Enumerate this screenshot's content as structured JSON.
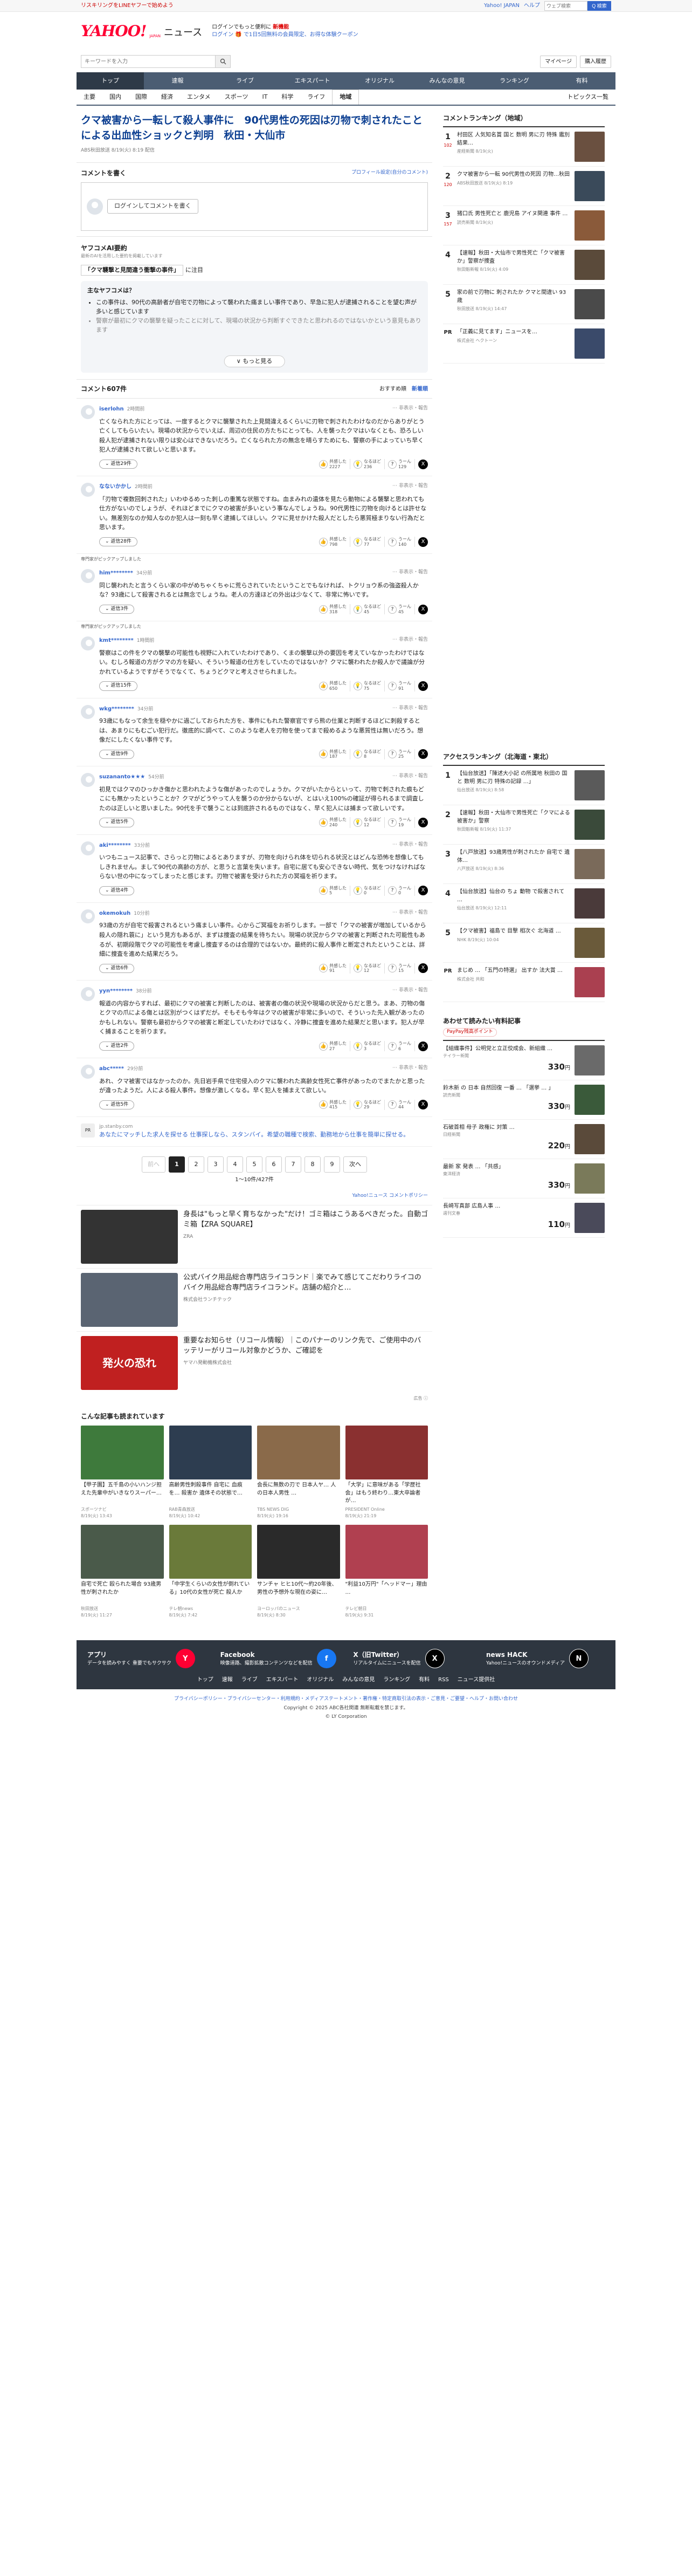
{
  "topbar": {
    "promo": "リスキリングをLINEヤフーで始めよう",
    "links": [
      "Yahoo! JAPAN",
      "ヘルプ"
    ],
    "search_placeholder": "ウェブ検索",
    "search_btn": "Q 検索"
  },
  "header": {
    "logo": "YAHOO!",
    "logo_sub": "JAPAN",
    "service": "ニュース",
    "promo1": "ログインでもっと便利に",
    "promo2": "ログイン 🎁 で1日5回無料の会員限定、お得な体験クーポン",
    "promo_highlight": "新機能"
  },
  "search": {
    "placeholder": "キーワードを入力",
    "actions": [
      "マイページ",
      "購入履歴"
    ]
  },
  "gnav": [
    "トップ",
    "速報",
    "ライブ",
    "エキスパート",
    "オリジナル",
    "みんなの意見",
    "ランキング",
    "有料"
  ],
  "snav": {
    "items": [
      "主要",
      "国内",
      "国際",
      "経済",
      "エンタメ",
      "スポーツ",
      "IT",
      "科学",
      "ライフ",
      "地域"
    ],
    "active": 9,
    "right": "トピックス一覧"
  },
  "article": {
    "title": "クマ被害から一転して殺人事件に　90代男性の死因は刃物で刺されたことによる出血性ショックと判明　秋田・大仙市",
    "meta": "ABS秋田放送 8/19(火) 8:19 配信"
  },
  "comment_form": {
    "heading": "コメントを書く",
    "settings": "プロフィール設定(自分のコメント)",
    "login": "ログインしてコメントを書く"
  },
  "ai": {
    "title": "ヤフコメAI要約",
    "sub": "最新のAIを活用した要約を掲載しています",
    "ref_prefix": "",
    "ref_highlight": "「クマ襲撃と見間違う衝撃の事件」",
    "ref_suffix": "に注目",
    "box_title": "主なヤフコメは？",
    "points": [
      "この事件は、90代の高齢者が自宅で刃物によって襲われた痛ましい事件であり、早急に犯人が逮捕されることを望む声が多いと感じています",
      "警察が最初にクマの襲撃を疑ったことに対して、現場の状況から判断すぐできたと思われるのではないかという意見もあります"
    ],
    "more": "∨ もっと見る"
  },
  "comments_header": {
    "title": "コメント607件",
    "sort1": "おすすめ順",
    "sort2": "新着順"
  },
  "comments": [
    {
      "user": "iserlohn",
      "time": "2時間前",
      "text": "亡くなられた方にとっては、一度するとクマに襲撃された上見間違えるくらいに刃物で刺されたわけなのだからありがとう亡くしてもらいたい。現場の状況からでいえば、周辺の住民の方たちにとっても、人を襲ったクマはいなくとも、恐ろしい殺人犯が逮捕されない限りは安心はできないだろう。亡くなられた方の無念を晴らすためにも、警察の手によっていち早く犯人が逮捕されて欲しいと思います。",
      "reply": "返信29件",
      "r1": "2227",
      "r2": "236",
      "r3": "129"
    },
    {
      "user": "なないかかし",
      "time": "2時間前",
      "text": "「刃物で複数回刺された」いわゆるめった刺しの重篤な状態ですね。血まみれの遺体を見たら動物による襲撃と思われても仕方がないのでしょうが、それほどまでにクマの被害が多いという事なんでしょうね。90代男性に刃物を向けるとは許せない。無差別なのか知人なのか犯人は一刻も早く逮捕してほしい。クマに見せかけた殺人だとしたら悪質極まりない行為だと思います。",
      "reply": "返信28件",
      "r1": "798",
      "r2": "77",
      "r3": "140"
    },
    {
      "user": "him********",
      "time": "34分前",
      "text": "同じ襲われたと言うくらい家の中がめちゃくちゃに荒らされていたということでもなければ、トクリョウ系の強盗殺人かな？93歳にして殺害されるとは無念でしょうね。老人の方達ほどの外出は少なくて、非常に怖いです。",
      "reply": "返信3件",
      "r1": "318",
      "r2": "45",
      "r3": "45",
      "pickup": "専門家がピックアップしました"
    },
    {
      "user": "kmt********",
      "time": "1時間前",
      "text": "警察はこの件をクマの襲撃の可能性も視野に入れていたわけであり、くまの襲撃以外の要因を考えていなかったわけではない。むしろ報道の方がクマの方を疑い、そういう報道の仕方をしていたのではないか？クマに襲われたか殺人かで議論が分かれているようですがそうでなくて、ちょうどクマと考えさせられました。",
      "reply": "返信15件",
      "r1": "650",
      "r2": "75",
      "r3": "91",
      "pickup": "専門家がピックアップしました"
    },
    {
      "user": "wkg********",
      "time": "34分前",
      "text": "93歳にもなって余生を穏やかに過ごしておられた方を、事件にもれた警察官ですら熊の仕業と判断するほどに刺殺するとは、あまりにもむごい犯行だ。徹底的に調べて、このような老人を刃物を使ってまで殺めるような悪質性は無いだろう。想像だにしたくない事件です。",
      "reply": "返信9件",
      "r1": "187",
      "r2": "8",
      "r3": "25"
    },
    {
      "user": "suzananto★★★",
      "time": "54分前",
      "text": "初見ではクマのひっかき傷かと思われたような傷があったのでしょうか。クマがいたからといって、刃物で刺された痕もどこにも無かったということか？クマがどうやって人を襲うのか分からないが、とはいえ100%の確証が得られるまで調査したのは正しいと思いました。90代を手で襲うことは到底許されるものではなく、早く犯人には捕まって欲しいです。",
      "reply": "返信5件",
      "r1": "240",
      "r2": "12",
      "r3": "19"
    },
    {
      "user": "aki********",
      "time": "33分前",
      "text": "いつもニュース記事で、さらっと刃物によるとありますが、刃物を向けられ体を切られる状況とはどんな恐怖を想像してもしきれません。まして90代の高齢の方が、と思うと言葉を失います。自宅に居ても安心できない時代、気をつけなければならない世の中になってしまったと感じます。刃物で被害を受けられた方の冥福を祈ります。",
      "reply": "返信4件",
      "r1": "5",
      "r2": "0",
      "r3": "0"
    },
    {
      "user": "okemokuh",
      "time": "10分前",
      "text": "93歳の方が自宅で殺害されるという痛ましい事件。心からご冥福をお祈りします。一部で「クマの被害が増加しているから殺人の隠れ蓑に」という見方もあるが、まずは捜査の結果を待ちたい。現場の状況からクマの被害と判断された可能性もあるが、初期段階でクマの可能性を考慮し捜査するのは合理的ではないか。最終的に殺人事件と断定されたということは、詳細に捜査を進めた結果だろう。",
      "reply": "返信6件",
      "r1": "91",
      "r2": "12",
      "r3": "15"
    },
    {
      "user": "yyn********",
      "time": "38分前",
      "text": "報道の内容からすれば、最初にクマの被害と判断したのは、被害者の傷の状況や現場の状況からだと思う。まあ、刃物の傷とクマの爪による傷とは区別がつくはずだが。そもそも今年はクマの被害が非常に多いので、そういった先入観があったのかもしれない。警察も最初からクマの被害と断定していたわけではなく、冷静に捜査を進めた結果だと思います。犯人が早く捕まることを祈ります。",
      "reply": "返信2件",
      "r1": "27",
      "r2": "3",
      "r3": "6"
    },
    {
      "user": "abc*****",
      "time": "29分前",
      "text": "あれ、クマ被害ではなかったのか。先日岩手県で住宅侵入のクマに襲われた高齢女性死亡事件があったのでまたかと思ったが違ったようだ。人による殺人事件。想像が激しくなる。早く犯人を捕まえて欲しい。",
      "reply": "返信5件",
      "r1": "415",
      "r2": "29",
      "r3": "44"
    }
  ],
  "promo_row": {
    "label": "PR",
    "source": "jp.stanby.com",
    "text": "あなたにマッチした求人を探せる 仕事探しなら、スタンバイ。希望の職種で検索、勤務地から仕事を簡単に探せる。"
  },
  "pager": {
    "prev": "前へ",
    "pages": [
      "1",
      "2",
      "3",
      "4",
      "5",
      "6",
      "7",
      "8",
      "9"
    ],
    "next": "次へ",
    "count": "1〜10件/427件"
  },
  "guide": "Yahoo!ニュース コメントポリシー",
  "ads": [
    {
      "title": "身長は\"もっと早く育ちなかった\"だけ！ゴミ箱はこうあるべきだった。自動ゴミ箱【ZRA SQUARE】",
      "sponsor": "ZRA",
      "color": "#333"
    },
    {
      "title": "公式バイク用品総合専門店ライコランド｜楽でみて感じてこだわりライコのバイク用品総合専門店ライコランド。店舗の紹介と…",
      "sponsor": "株式会社ランチテック",
      "color": "#5a6472"
    },
    {
      "title": "重要なお知らせ（リコール情報）｜このパナーのリンク先で、ご使用中のバッテリーがリコール対象かどうか、ご確認を",
      "sponsor": "ヤマハ発動機株式会社",
      "color": "#c02020",
      "banner": "発火の恐れ"
    }
  ],
  "ad_note": "広告 ⓘ",
  "related": {
    "title": "こんな記事も読まれています",
    "items": [
      {
        "title": "【甲子園】五千島の小いハンジ担えた先輩中がいきなりスーパー…",
        "src": "スポーツナビ",
        "time": "8/19(火) 13:43",
        "color": "#3e7a3c"
      },
      {
        "title": "高齢男性刺殺事件 自宅に 血痕を… 殺害か 遺体その状態で…",
        "src": "RAB青森放送",
        "time": "8/19(火) 10:42",
        "color": "#2d3d50"
      },
      {
        "title": "会長に無数の刃で 日本人ヤ… 人の日本人男性 …",
        "src": "TBS NEWS DIG",
        "time": "8/19(火) 19:16",
        "color": "#8a6a4a"
      },
      {
        "title": "「大学」に意味がある「学歴社会」はもう終わり…東大卒論者が…",
        "src": "PRESIDENT Online",
        "time": "8/19(火) 21:19",
        "color": "#8a3030"
      },
      {
        "title": "自宅で死亡 殴られた場合 93歳男性が刺されたか",
        "src": "秋田放送",
        "time": "8/19(火) 11:27",
        "color": "#4a5a4a"
      },
      {
        "title": "「中学生くらいの女性が倒れている」10代の女性が死亡 殺人か",
        "src": "テレ朝news",
        "time": "8/19(火) 7:42",
        "color": "#6a7a3a"
      },
      {
        "title": "サンチャ ヒヒ10代〜約20年後、男性の予想外な現在の姿に…",
        "src": "ヨーロッパのニュース",
        "time": "8/19(火) 8:30",
        "color": "#2a2a2a"
      },
      {
        "title": "\"利益10万円\"「ヘッドマー」理由 …",
        "src": "テレビ朝日",
        "time": "8/19(火) 9:31",
        "color": "#b04050"
      }
    ]
  },
  "side_ranking": {
    "title": "コメントランキング（地域）",
    "items": [
      {
        "n": "1",
        "c": "102",
        "t": "村田区 人気知名賞 国と 数明 男に刃 特殊 鑑別結果…",
        "s": "産経新聞 8/19(火)",
        "color": "#6a5040"
      },
      {
        "n": "2",
        "c": "120",
        "t": "クマ被害から一転 90代男性の死因 刃物…秋田",
        "s": "ABS秋田放送 8/19(火) 8:19",
        "color": "#3a4a5a"
      },
      {
        "n": "3",
        "c": "157",
        "t": "猪口氏 男性死亡と 鹿児島 アイヌ関連 事件 …",
        "s": "読売新聞 8/19(火)",
        "color": "#8a5a3a"
      },
      {
        "n": "4",
        "c": "",
        "t": "【速報】秋田・大仙市で男性死亡「クマ被害か」警察が捜査",
        "s": "秋田魁新報 8/19(火) 4:09",
        "color": "#5a4a3a"
      },
      {
        "n": "5",
        "c": "",
        "t": "家の前で刃物に 刺されたか クマと間違い 93歳",
        "s": "秋田放送 8/19(火) 14:47",
        "color": "#4a4a4a"
      }
    ],
    "pr": {
      "t": "「正義に見てます」ニュースを…",
      "s": "株式会社 ヘクトーン",
      "color": "#3a4a6a"
    }
  },
  "side_access": {
    "title": "アクセスランキング（北海道・東北）",
    "items": [
      {
        "n": "1",
        "t": "【仙台放送】「陳述大小記 の所属地 秋田の 国と 数明 男に刃 特殊の記録 …」",
        "s": "仙台放送 8/19(火) 8:58",
        "color": "#5a5a5a"
      },
      {
        "n": "2",
        "t": "【速報】秋田・大仙市で男性死亡「クマによる被害か」警察",
        "s": "秋田魁新報 8/19(火) 11:37",
        "color": "#3a4a3a"
      },
      {
        "n": "3",
        "t": "【八戸放送】93歳男性が刺されたか 自宅で 遺体…",
        "s": "八戸放送 8/19(火) 8:36",
        "color": "#7a6a5a"
      },
      {
        "n": "4",
        "t": "【仙台放送】仙台の ちょ 動物 で殺害されて …",
        "s": "仙台放送 8/19(火) 12:11",
        "color": "#4a3a3a"
      },
      {
        "n": "5",
        "t": "【クマ被害】福島で 目撃 相次ぐ 北海道 …",
        "s": "NHK 8/19(火) 10:04",
        "color": "#6a5a3a"
      }
    ],
    "pr": {
      "t": "まじめ … 「五門の特選」 出すか 法大賞 …",
      "s": "株式会社 共和",
      "color": "#aa4050"
    }
  },
  "side_cheap": {
    "title": "あわせて読みたい有料記事",
    "paypay": "PayPay残高ポイント",
    "items": [
      {
        "t": "【組織事件】公明党と立正佼成会、新組織 …",
        "s": "テイラー新聞",
        "p": "330",
        "color": "#6a6a6a"
      },
      {
        "t": "鈴木新 の 日本 自然回復 一番 … 「選挙 … 」",
        "s": "読売新聞",
        "p": "330",
        "color": "#3a5a3a"
      },
      {
        "t": "石破首相 母子 政権に 対策 …",
        "s": "日経新聞",
        "p": "220",
        "color": "#5a4a3a"
      },
      {
        "t": "最新 家 発表 … 「共感」",
        "s": "東洋経済",
        "p": "330",
        "color": "#7a7a5a"
      },
      {
        "t": "長崎写真部 広島人事 …",
        "s": "週刊文春",
        "p": "110",
        "color": "#4a4a5a"
      }
    ]
  },
  "footer": {
    "apps": [
      {
        "name": "アプリ",
        "desc": "データを読みやすく 重要でもサクサク",
        "icon": "Y",
        "color": "#ff0033"
      },
      {
        "name": "Facebook",
        "desc": "映像道路、撮影拡散コンテンツなどを配信",
        "icon": "f",
        "color": "#1877f2"
      },
      {
        "name": "X（旧Twitter）",
        "desc": "リアルタイムにニュースを配信",
        "icon": "X",
        "color": "#000000"
      },
      {
        "name": "news HACK",
        "desc": "Yahoo!ニュースのオウンドメディア",
        "icon": "N",
        "color": "#000000"
      }
    ],
    "links": [
      "トップ",
      "速報",
      "ライブ",
      "エキスパート",
      "オリジナル",
      "みんなの意見",
      "ランキング",
      "有料",
      "RSS",
      "ニュース提供社"
    ],
    "bottom1": "プライバシーポリシー・プライバシーセンター・利用規約・メディアステートメント・著作権・特定商取引法の表示・ご意見・ご要望・ヘルプ・お問い合わせ",
    "bottom2": "Copyright © 2025 ABC各社関連 無断転載を禁じます。",
    "bottom3": "© LY Corporation"
  }
}
